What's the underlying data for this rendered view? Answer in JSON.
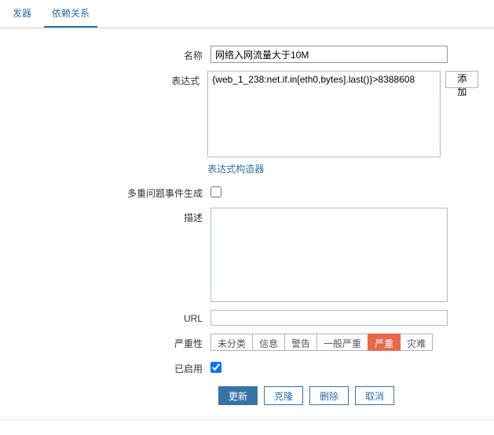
{
  "tabs": {
    "trigger": "发器",
    "dependency": "依赖关系"
  },
  "labels": {
    "name": "名称",
    "expression": "表达式",
    "expression_builder": "表达式构造器",
    "multi_event": "多重问题事件生成",
    "description": "描述",
    "url": "URL",
    "severity": "严重性",
    "enabled": "已启用"
  },
  "values": {
    "name": "网络入网流量大于10M",
    "expression": "{web_1_238:net.if.in[eth0,bytes].last()}>8388608",
    "description": "",
    "url": "",
    "multi_event": false,
    "enabled": true,
    "selected_severity": "严重"
  },
  "buttons": {
    "add": "添加",
    "update": "更新",
    "clone": "克隆",
    "delete": "删除",
    "cancel": "取消"
  },
  "severity_options": [
    "未分类",
    "信息",
    "警告",
    "一般严重",
    "严重",
    "灾难"
  ]
}
